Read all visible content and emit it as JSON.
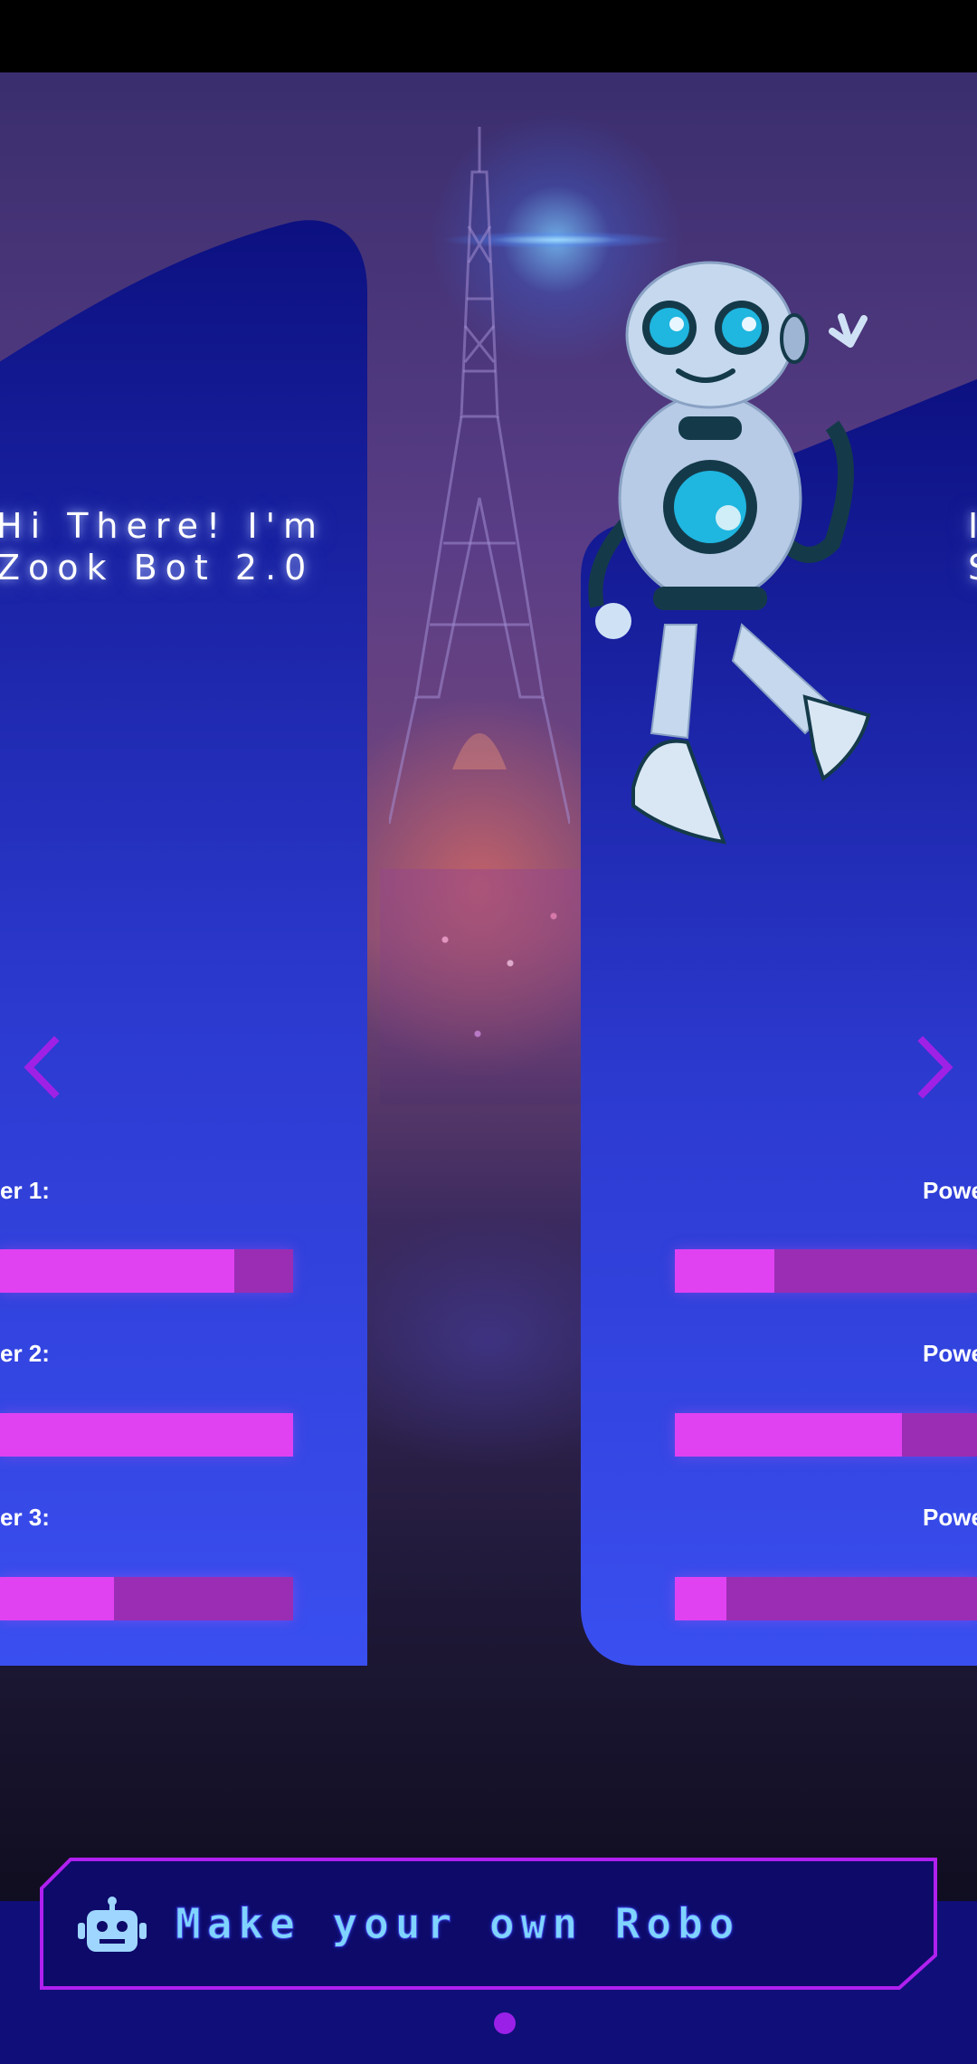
{
  "carousel": {
    "left_card": {
      "title_line1": "Hi There! I'm",
      "title_line2": "Zook Bot 2.0",
      "powers": [
        {
          "label": "er 1:",
          "level": 0.8
        },
        {
          "label": "er 2:",
          "level": 1.0
        },
        {
          "label": "er 3:",
          "level": 0.39
        }
      ]
    },
    "right_card": {
      "title_line1": "I",
      "title_line2": "S",
      "powers": [
        {
          "label": "Powe",
          "level": 0.33
        },
        {
          "label": "Powe",
          "level": 0.75
        },
        {
          "label": "Powe",
          "level": 0.17
        }
      ]
    },
    "prev_icon": "chevron-left-icon",
    "next_icon": "chevron-right-icon"
  },
  "cta": {
    "label": "Make your own Robo",
    "icon": "robot-icon"
  },
  "pagination": {
    "active": 1,
    "count": 1
  },
  "colors": {
    "accent": "#e042f2",
    "bar_track": "#9b2db4",
    "arrow": "#a021e6",
    "cta_border": "#b020f0",
    "cta_text": "#7fd4ff",
    "card_top": "#0c1080",
    "card_bottom": "#3a4ff0"
  }
}
